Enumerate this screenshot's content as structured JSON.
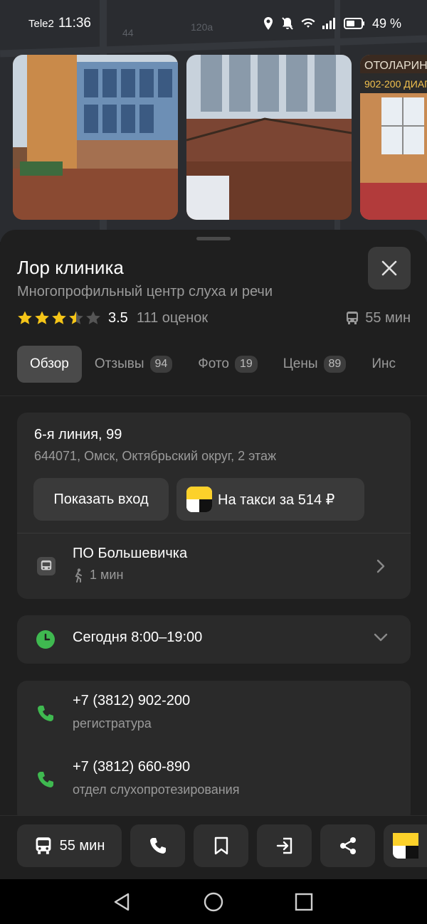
{
  "status_bar": {
    "carrier": "Tele2",
    "time": "11:36",
    "battery": "49 %"
  },
  "map": {
    "labels": [
      "44",
      "120а"
    ]
  },
  "photos": [
    {
      "alt": "building-facade"
    },
    {
      "alt": "building-entrance"
    },
    {
      "alt": "clinic-sign",
      "sign_top": "ОТОЛАРИН",
      "sign_bottom": "902-200 ДИАГ"
    }
  ],
  "place": {
    "title": "Лор клиника",
    "subtitle": "Многопрофильный центр слуха и речи",
    "rating": "3.5",
    "rating_value": 3.5,
    "rating_count": "111 оценок",
    "route_time": "55 мин"
  },
  "tabs": [
    {
      "label": "Обзор",
      "badge": ""
    },
    {
      "label": "Отзывы",
      "badge": "94"
    },
    {
      "label": "Фото",
      "badge": "19"
    },
    {
      "label": "Цены",
      "badge": "89"
    },
    {
      "label": "Инс",
      "badge": ""
    }
  ],
  "address": {
    "main": "6-я линия, 99",
    "sub": "644071, Омск, Октябрьский округ, 2 этаж",
    "show_entrance": "Показать вход",
    "taxi": "На такси за 514 ₽"
  },
  "stop": {
    "name": "ПО Большевичка",
    "walk": "1 мин"
  },
  "hours": {
    "text": "Сегодня 8:00–19:00"
  },
  "phones": [
    {
      "number": "+7 (3812) 902-200",
      "label": "регистратура"
    },
    {
      "number": "+7 (3812) 660-890",
      "label": "отдел слухопротезирования"
    }
  ],
  "actions": {
    "route": "55 мин"
  },
  "colors": {
    "accent_green": "#3fb950",
    "star": "#f5c518",
    "taxi_yellow": "#fcd12a"
  }
}
